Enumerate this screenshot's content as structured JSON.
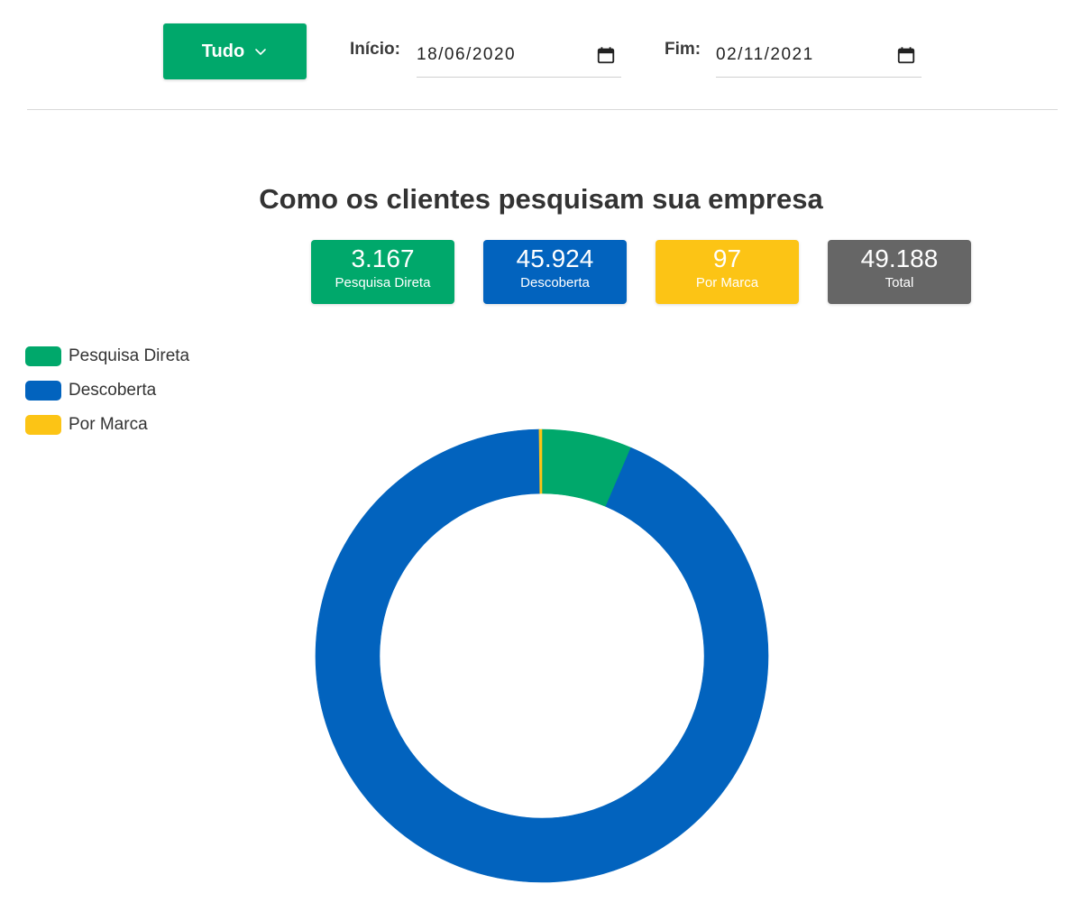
{
  "filters": {
    "period_button_label": "Tudo",
    "start_label": "Início:",
    "start_value": "18/06/2020",
    "end_label": "Fim:",
    "end_value": "02/11/2021"
  },
  "colors": {
    "pesquisa_direta": "#00A86B",
    "descoberta": "#0263BE",
    "por_marca": "#FCC415",
    "total": "#666666"
  },
  "summary": [
    {
      "value": "3.167",
      "label": "Pesquisa Direta"
    },
    {
      "value": "45.924",
      "label": "Descoberta"
    },
    {
      "value": "97",
      "label": "Por Marca"
    },
    {
      "value": "49.188",
      "label": "Total"
    }
  ],
  "chart_data": {
    "type": "pie",
    "title": "Como os clientes pesquisam sua empresa",
    "donut": true,
    "legend_position": "top-left",
    "categories": [
      "Pesquisa Direta",
      "Descoberta",
      "Por Marca"
    ],
    "values": [
      3167,
      45924,
      97
    ],
    "total": 49188
  }
}
